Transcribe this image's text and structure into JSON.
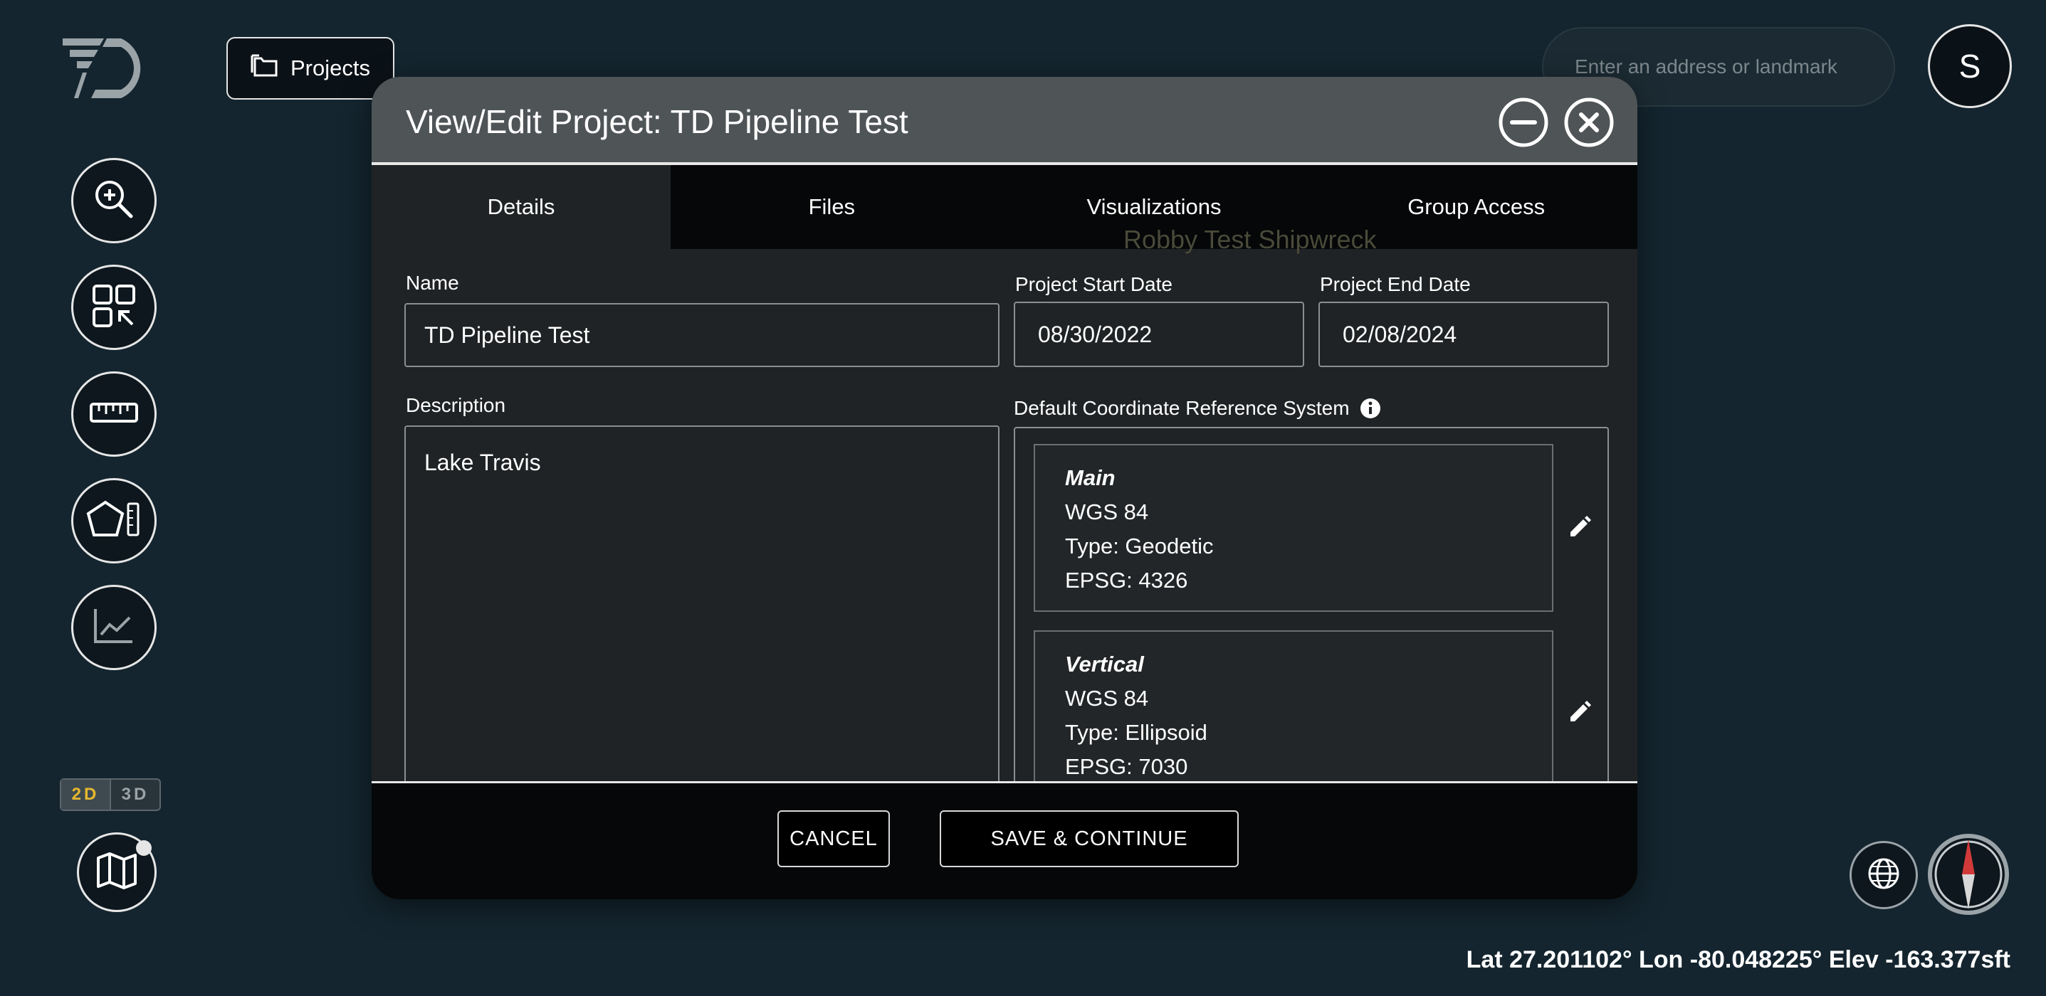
{
  "header": {
    "projects_label": "Projects",
    "search_placeholder": "Enter an address or landmark",
    "avatar_initial": "S"
  },
  "toolbar": {
    "tools": [
      "zoom-in-icon",
      "qr-scan-icon",
      "ruler-icon",
      "polygon-measure-icon",
      "line-chart-icon"
    ],
    "dim_2d": "2D",
    "dim_3d": "3D",
    "active_dim": "2D"
  },
  "modal": {
    "title": "View/Edit Project: TD Pipeline Test",
    "tabs": [
      "Details",
      "Files",
      "Visualizations",
      "Group Access"
    ],
    "active_tab": "Details",
    "fields": {
      "name_label": "Name",
      "name_value": "TD Pipeline Test",
      "start_label": "Project Start Date",
      "start_value": "08/30/2022",
      "end_label": "Project End Date",
      "end_value": "02/08/2024",
      "description_label": "Description",
      "description_value": "Lake Travis",
      "crs_label": "Default Coordinate Reference System"
    },
    "crs": [
      {
        "title": "Main",
        "name": "WGS 84",
        "type": "Type: Geodetic",
        "epsg": "EPSG: 4326"
      },
      {
        "title": "Vertical",
        "name": "WGS 84",
        "type": "Type: Ellipsoid",
        "epsg": "EPSG: 7030"
      }
    ],
    "cancel_label": "CANCEL",
    "save_label": "SAVE & CONTINUE"
  },
  "map": {
    "background_label": "Robby Test Shipwreck"
  },
  "status": {
    "coords": "Lat 27.201102° Lon -80.048225° Elev -163.377sft"
  },
  "colors": {
    "background": "#14252f",
    "modal_header": "#4f5457",
    "modal_body": "#202325",
    "accent_2d": "#e6b830"
  }
}
